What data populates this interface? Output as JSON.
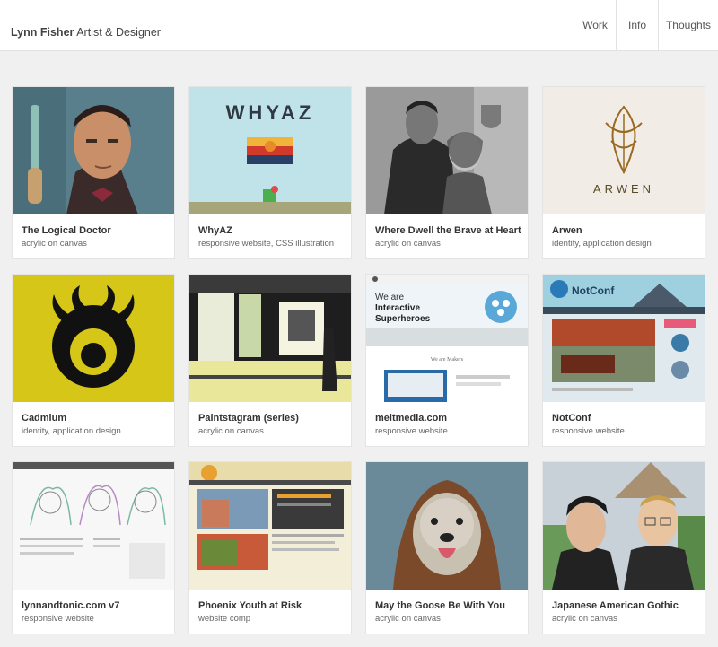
{
  "header": {
    "brand_name": "Lynn Fisher",
    "brand_tagline": "Artist & Designer",
    "nav": [
      "Work",
      "Info",
      "Thoughts"
    ]
  },
  "projects": [
    {
      "title": "The Logical Doctor",
      "subtitle": "acrylic on canvas"
    },
    {
      "title": "WhyAZ",
      "subtitle": "responsive website, CSS illustration",
      "thumb_text": "WHYAZ"
    },
    {
      "title": "Where Dwell the Brave at Heart",
      "subtitle": "acrylic on canvas"
    },
    {
      "title": "Arwen",
      "subtitle": "identity, application design",
      "thumb_text": "ARWEN"
    },
    {
      "title": "Cadmium",
      "subtitle": "identity, application design"
    },
    {
      "title": "Paintstagram (series)",
      "subtitle": "acrylic on canvas"
    },
    {
      "title": "meltmedia.com",
      "subtitle": "responsive website",
      "thumb_text": [
        "We are",
        "Interactive",
        "Superheroes",
        "We are Makers"
      ]
    },
    {
      "title": "NotConf",
      "subtitle": "responsive website",
      "thumb_text": [
        "NotConf"
      ]
    },
    {
      "title": "lynnandtonic.com v7",
      "subtitle": "responsive website"
    },
    {
      "title": "Phoenix Youth at Risk",
      "subtitle": "website comp"
    },
    {
      "title": "May the Goose Be With You",
      "subtitle": "acrylic on canvas"
    },
    {
      "title": "Japanese American Gothic",
      "subtitle": "acrylic on canvas"
    }
  ],
  "colors": {
    "page_bg": "#f0f0f0",
    "card_bg": "#ffffff",
    "whyaz_bg": "#bfe3e8",
    "cadmium_bg": "#d6c617",
    "arwen_gold": "#9a6a22"
  }
}
